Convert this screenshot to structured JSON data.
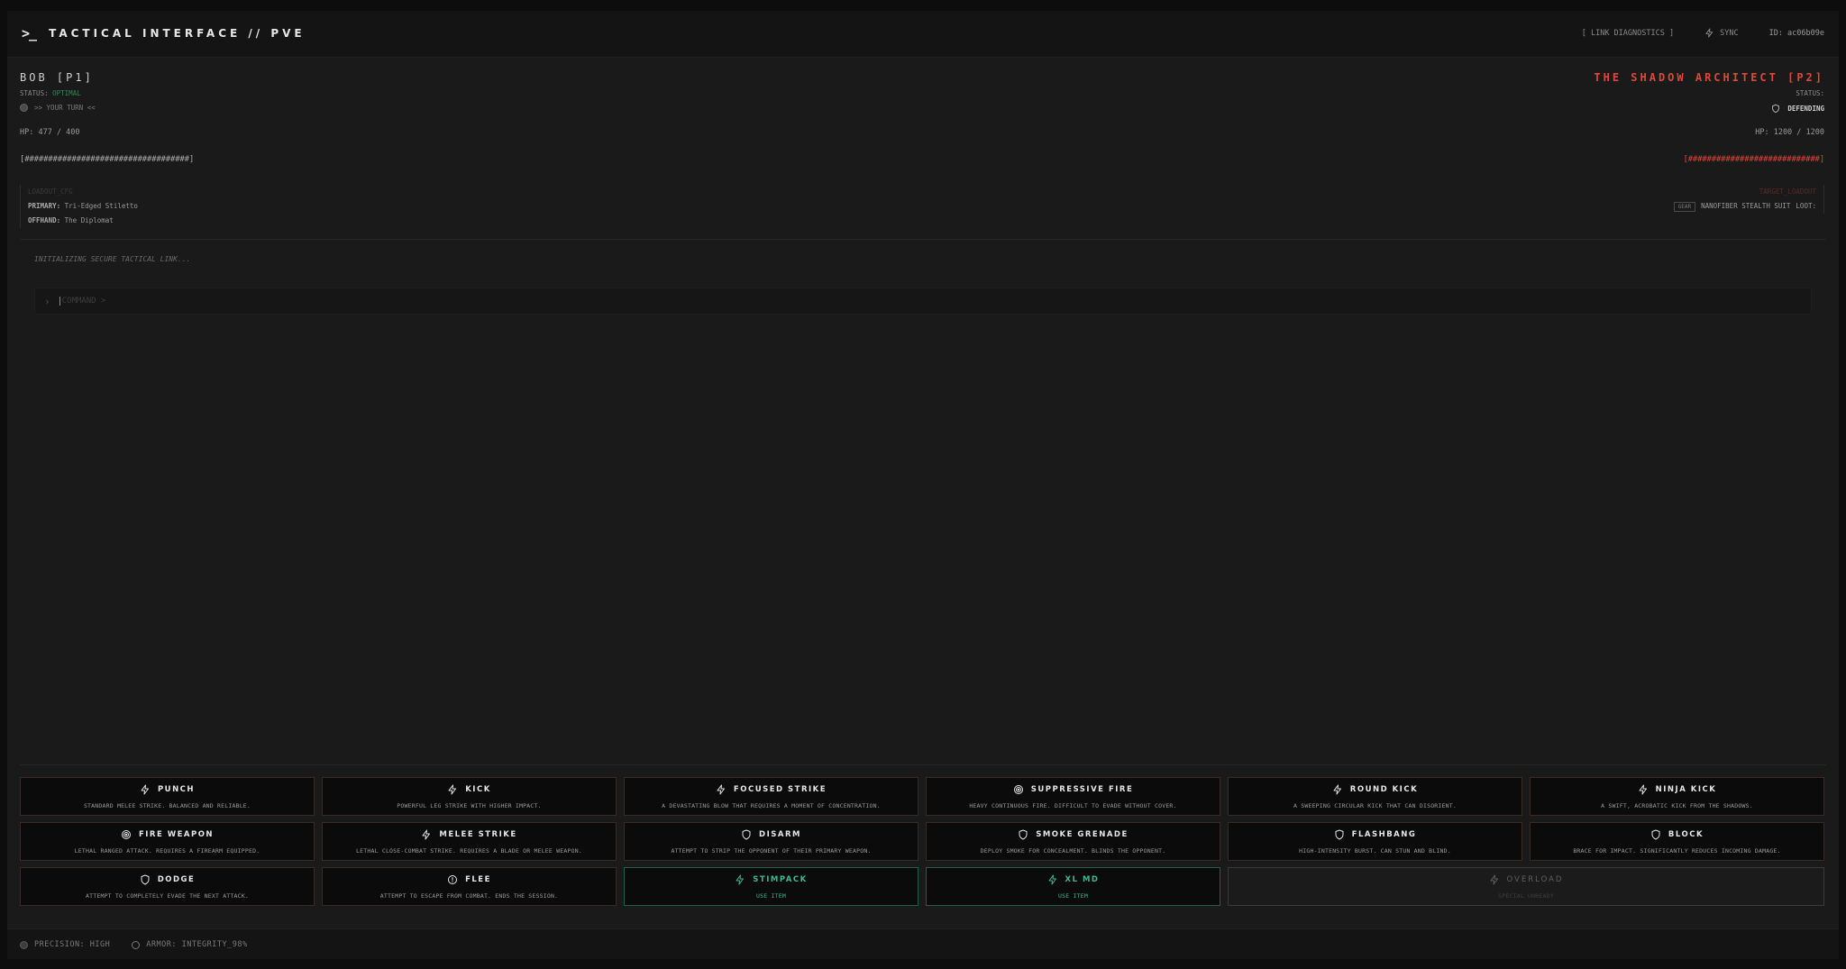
{
  "header": {
    "prompt": ">_",
    "title": "TACTICAL INTERFACE // PVE",
    "diagnostics": "[ LINK DIAGNOSTICS ]",
    "sync": "SYNC",
    "id": "ID: ac06b09e"
  },
  "player1": {
    "name": "BOB [P1]",
    "status_label": "STATUS:",
    "status_value": "OPTIMAL",
    "turn": ">> YOUR TURN <<",
    "hp": "HP: 477 / 400",
    "bar": "[###################################]",
    "loadout_head": "LOADOUT_CFG",
    "primary_label": "PRIMARY:",
    "primary_value": "Tri-Edged Stiletto",
    "offhand_label": "OFFHAND:",
    "offhand_value": "The Diplomat"
  },
  "player2": {
    "name": "THE SHADOW ARCHITECT [P2]",
    "status_label": "STATUS:",
    "state": "DEFENDING",
    "hp": "HP: 1200 / 1200",
    "bar": "[############################]",
    "loadout_head": "TARGET_LOADOUT",
    "gear_tag": "GEAR",
    "gear_value": "NANOFIBER STEALTH SUIT",
    "loot_label": "LOOT:"
  },
  "terminal": {
    "line": "INITIALIZING SECURE TACTICAL LINK...",
    "placeholder": "COMMAND >"
  },
  "actions": [
    {
      "name": "PUNCH",
      "desc": "STANDARD MELEE STRIKE. BALANCED AND RELIABLE.",
      "icon": "bolt-icon"
    },
    {
      "name": "KICK",
      "desc": "POWERFUL LEG STRIKE WITH HIGHER IMPACT.",
      "icon": "bolt-icon"
    },
    {
      "name": "FOCUSED STRIKE",
      "desc": "A DEVASTATING BLOW THAT REQUIRES A MOMENT OF CONCENTRATION.",
      "icon": "bolt-icon"
    },
    {
      "name": "SUPPRESSIVE FIRE",
      "desc": "HEAVY CONTINUOUS FIRE. DIFFICULT TO EVADE WITHOUT COVER.",
      "icon": "target-icon"
    },
    {
      "name": "ROUND KICK",
      "desc": "A SWEEPING CIRCULAR KICK THAT CAN DISORIENT.",
      "icon": "bolt-icon"
    },
    {
      "name": "NINJA KICK",
      "desc": "A SWIFT, ACROBATIC KICK FROM THE SHADOWS.",
      "icon": "bolt-icon"
    },
    {
      "name": "FIRE WEAPON",
      "desc": "LETHAL RANGED ATTACK. REQUIRES A FIREARM EQUIPPED.",
      "icon": "target-icon"
    },
    {
      "name": "MELEE STRIKE",
      "desc": "LETHAL CLOSE-COMBAT STRIKE. REQUIRES A BLADE OR MELEE WEAPON.",
      "icon": "bolt-icon"
    },
    {
      "name": "DISARM",
      "desc": "ATTEMPT TO STRIP THE OPPONENT OF THEIR PRIMARY WEAPON.",
      "icon": "shield-icon"
    },
    {
      "name": "SMOKE GRENADE",
      "desc": "DEPLOY SMOKE FOR CONCEALMENT. BLINDS THE OPPONENT.",
      "icon": "shield-icon"
    },
    {
      "name": "FLASHBANG",
      "desc": "HIGH-INTENSITY BURST. CAN STUN AND BLIND.",
      "icon": "shield-icon"
    },
    {
      "name": "BLOCK",
      "desc": "BRACE FOR IMPACT. SIGNIFICANTLY REDUCES INCOMING DAMAGE.",
      "icon": "shield-icon"
    },
    {
      "name": "DODGE",
      "desc": "ATTEMPT TO COMPLETELY EVADE THE NEXT ATTACK.",
      "icon": "shield-icon"
    },
    {
      "name": "FLEE",
      "desc": "ATTEMPT TO ESCAPE FROM COMBAT. ENDS THE SESSION.",
      "icon": "alert-icon"
    },
    {
      "name": "STIMPACK",
      "desc": "USE ITEM",
      "icon": "bolt-icon",
      "kind": "item"
    },
    {
      "name": "XL MD",
      "desc": "USE ITEM",
      "icon": "bolt-icon",
      "kind": "item"
    },
    {
      "name": "OVERLOAD",
      "desc": "SPECIAL UNREADY",
      "icon": "bolt-icon",
      "kind": "special"
    }
  ],
  "footer": {
    "precision": "PRECISION: HIGH",
    "armor": "ARMOR: INTEGRITY_98%"
  },
  "colors": {
    "accent_red": "#e0463a",
    "item_green": "#3fb890",
    "status_green": "#2e8a54"
  }
}
